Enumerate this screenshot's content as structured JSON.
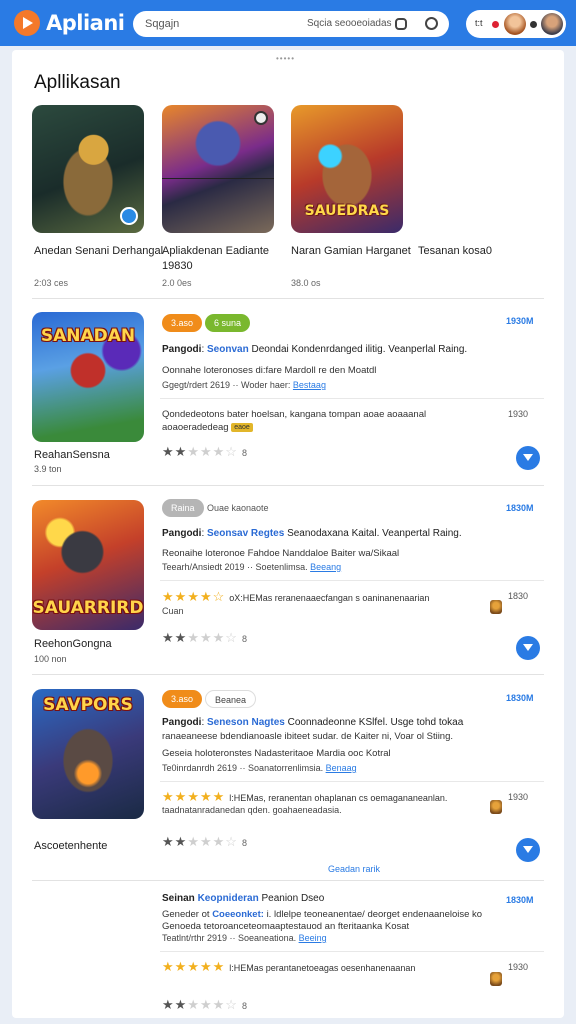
{
  "header": {
    "app_title": "Apliani",
    "search_placeholder": "Search",
    "search_value": "Sqgajn",
    "search_hint": "Sqcia seooeoiadas",
    "profile_text": "t:t"
  },
  "page_title": "Apllikasan",
  "featured": [
    {
      "name": "Anedan Senani Derhangal",
      "sub": "2:03 ces"
    },
    {
      "name": "Apliakdenan Eadiante 19830",
      "sub": "2.0 0es"
    },
    {
      "name": "Naran Gamian Harganet",
      "sub": "38.0 os"
    },
    {
      "name": "Tesanan kosa0",
      "sub": ""
    }
  ],
  "featured_art": {
    "ft3_title": "SAUEDRAS"
  },
  "cards": [
    {
      "art_title": "SANADAN",
      "name": "ReahanSensna",
      "sub": "3.9 ton",
      "tags": [
        "3.aso",
        "6 suna"
      ],
      "size": "1930M",
      "headline_a": "Pangodi",
      "headline_b": "Seonvan",
      ",headline_c": "",
      "headline_c": "Deondai Kondenrdanged ilitig. Veanperlal Raing.",
      "line1": "Oonnahe loteronoses di:fare Mardoll re den Moatdl",
      "line2_a": "Ggegt/rdert 2619 ·· Woder haer:",
      "line2_link": "Bestaag",
      "detail": "Qondedeotons bater hoelsan, kangana tompan aoae aoaaanal",
      "detail2": "aoaoeradedeag",
      "detail_badge": "eaoe",
      "detail_size": "1930",
      "rating": 2,
      "rating_text": "8"
    },
    {
      "art_title": "SAUARRIRD",
      "name": "ReehonGongna",
      "sub": "100 non",
      "tags": [
        "Raina",
        "Ouae kaonaote"
      ],
      "size": "1830M",
      "headline_a": "Pangodi",
      "headline_b": "Seonsav Regtes",
      "headline_c": "Seanodaxana Kaital. Veanpertal Raing.",
      "line1": "Reonaihe loteronoe Fahdoe Nanddaloe Baiter wa/Sikaal",
      "line2_a": "Teearh/Ansiedt 2019 ·· Soetenlimsa.",
      "line2_link": "Beeang",
      "gold_stars": 4.5,
      "gold_text": "oX:HEMas reranenaaecfangan s oaninanenaarian",
      "gold_sub": "Cuan",
      "gold_size": "1830",
      "rating": 2,
      "rating_text": "8"
    },
    {
      "art_title": "SAVPORS",
      "name": "Ascoetenhente",
      "sub": "",
      "tags": [
        "3.aso",
        "Beanea"
      ],
      "size": "1830M",
      "headline_a": "Pangodi",
      "headline_b": "Seneson Nagtes",
      "headline_c": "Coonnadeonne KSlfel. Usge tohd tokaa",
      "line1b": "ranaeaneese bdendianoasle ibiteet sudar. de Kaiter ni, Voar ol Stiing.",
      "line1": "Geseia holoteronstes Nadasteritaoe Mardia ooc Kotral",
      "line2_a": "Te0inrdanrdh 2619 ·· Soanatorrenlimsia.",
      "line2_link": "Benaag",
      "gold_stars": 5,
      "gold_text": "l:HEMas, reranentan ohaplanan cs oemagananeanlan.",
      "gold_sub": "taadnatanradanedan qden. goahaeneadasia.",
      "gold_size": "1930",
      "rating": 2,
      "rating_text": "8"
    }
  ],
  "show_more": "Geadan rarik",
  "bottom": {
    "headline_a": "Seinan",
    "headline_b": "Keopnideran",
    "headline_c": "Peanion Dseo",
    "size": "1830M",
    "line1_a": "Geneder ot",
    "line1_b": "Coeeonket:",
    "line1_c": "i. ldlelpe teoneanentae/ deorget endenaaneloise ko",
    "line1d": "Genoeda tetoroanceteomaaptestauod an fteritaanka Kosat",
    "line2_a": "Teatlnt/rthr 2919 ·· Soeaneationa.",
    "line2_link": "Beeing",
    "gold_stars": 5,
    "gold_text": "l:HEMas perantanetoeagas oesenhanenaanan",
    "gold_size": "1930",
    "rating": 2,
    "rating_text": "8"
  },
  "colors": {
    "brand": "#2a7be4",
    "accent_orange": "#f08c1a",
    "star_gold": "#f2b01e"
  },
  "icons": [
    "play-logo-icon",
    "search-icon",
    "camera-icon",
    "download-icon",
    "star-icon"
  ]
}
